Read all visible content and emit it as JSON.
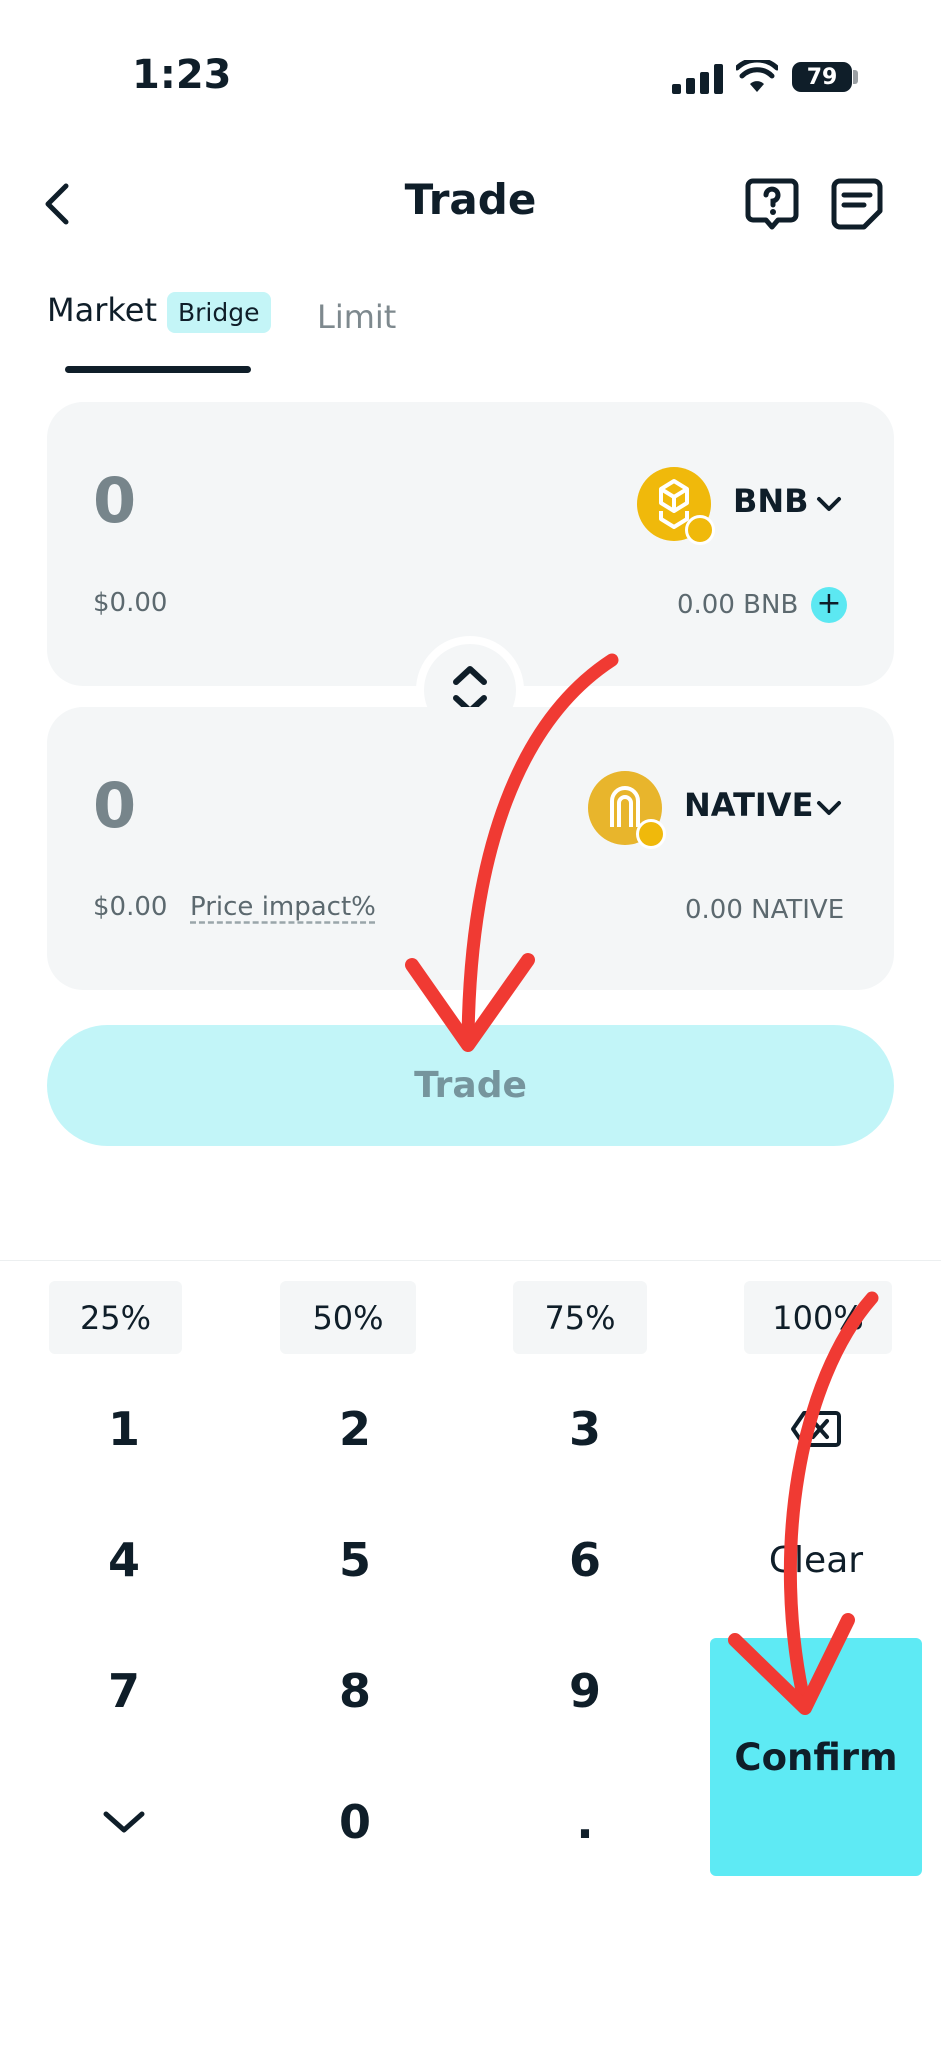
{
  "status_bar": {
    "time": "1:23",
    "battery": "79"
  },
  "header": {
    "title": "Trade"
  },
  "tabs": {
    "market": "Market",
    "market_badge": "Bridge",
    "limit": "Limit"
  },
  "from": {
    "amount": "0",
    "usd": "$0.00",
    "token": "BNB",
    "balance": "0.00 BNB",
    "add": "+"
  },
  "to": {
    "amount": "0",
    "usd": "$0.00",
    "price_impact": "Price impact%",
    "token": "NATIVE",
    "balance": "0.00 NATIVE"
  },
  "trade_button": "Trade",
  "percent_buttons": [
    "25%",
    "50%",
    "75%",
    "100%"
  ],
  "keypad": {
    "k1": "1",
    "k2": "2",
    "k3": "3",
    "k4": "4",
    "k5": "5",
    "k6": "6",
    "k7": "7",
    "k8": "8",
    "k9": "9",
    "k0": "0",
    "dot": ".",
    "clear": "Clear",
    "confirm": "Confirm"
  },
  "colors": {
    "accent": "#5eeaf4",
    "accent_light": "#c2f5f8",
    "text": "#0f1e29",
    "card": "#f4f6f7",
    "annotation": "#f03a33",
    "coin": "#f0b90b"
  },
  "icons": [
    "back-icon",
    "help-icon",
    "notes-icon",
    "chevron-down-icon",
    "swap-icon",
    "backspace-icon",
    "hide-keyboard-icon",
    "signal-icon",
    "wifi-icon"
  ]
}
